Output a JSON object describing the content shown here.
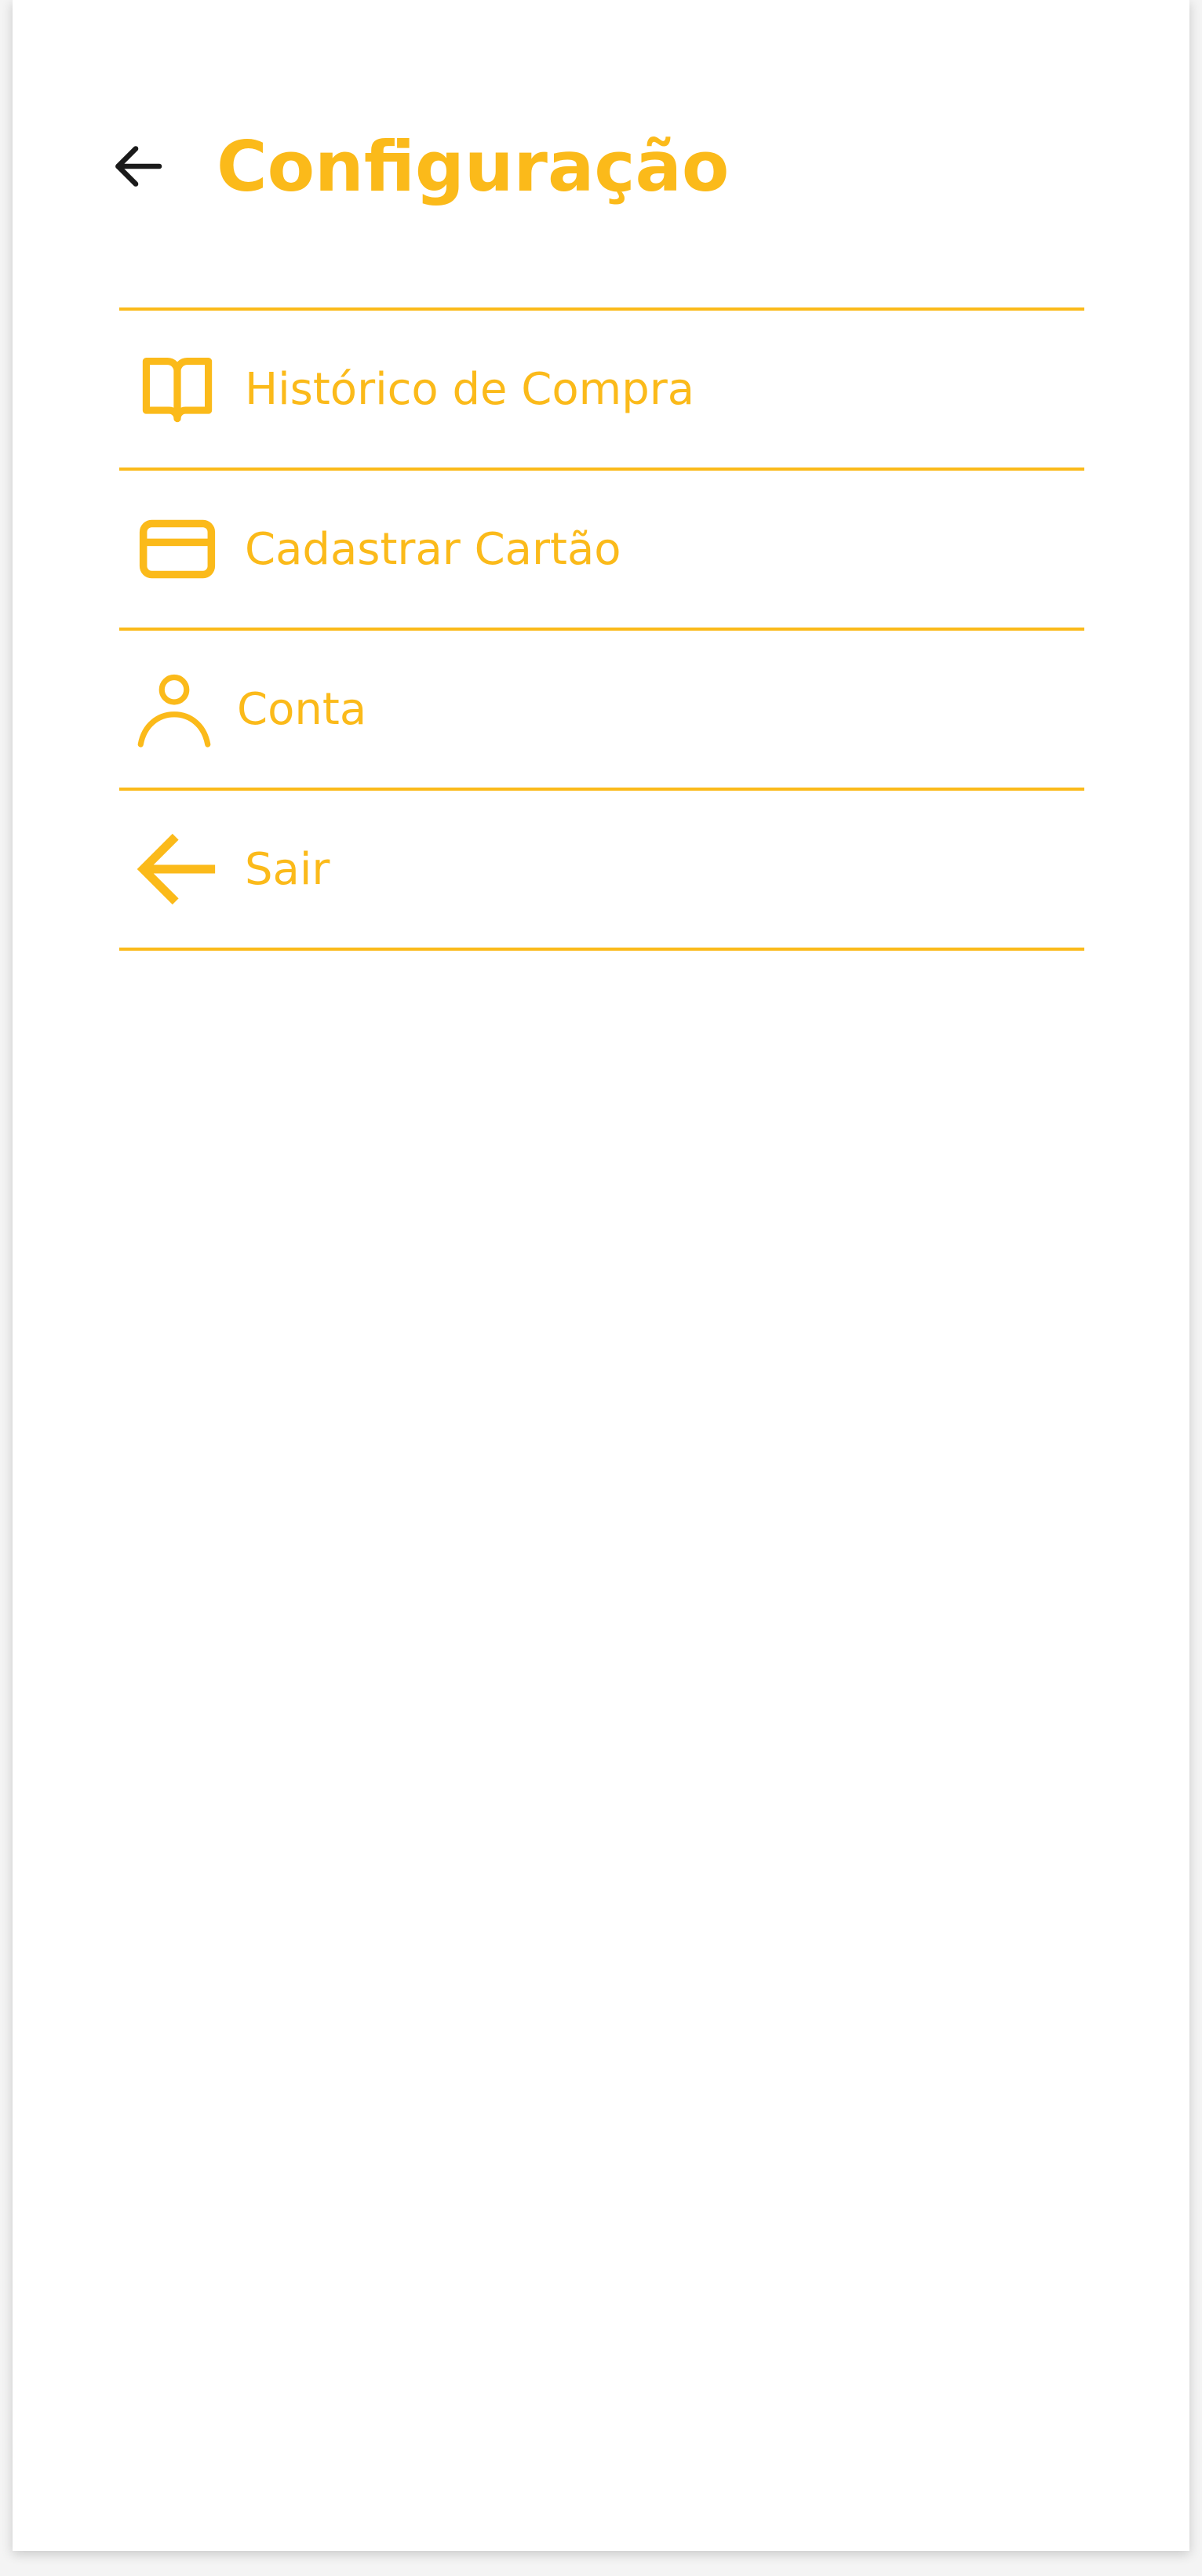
{
  "header": {
    "title": "Configuração",
    "back_icon": "arrow-left-icon"
  },
  "menu": {
    "items": [
      {
        "label": "Histórico de Compra",
        "icon": "book-icon"
      },
      {
        "label": "Cadastrar Cartão",
        "icon": "credit-card-icon"
      },
      {
        "label": "Conta",
        "icon": "user-icon"
      },
      {
        "label": "Sair",
        "icon": "logout-arrow-icon"
      }
    ]
  },
  "colors": {
    "accent": "#FBBA1A",
    "text_dark": "#1a1a1a",
    "background": "#ffffff"
  }
}
